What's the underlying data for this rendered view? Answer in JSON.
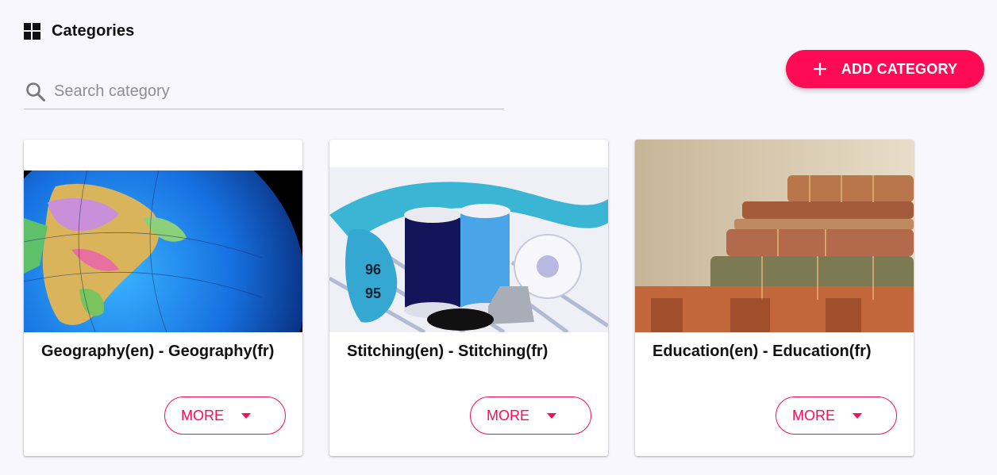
{
  "header": {
    "title": "Categories",
    "icon": "dashboard-grid-icon"
  },
  "search": {
    "placeholder": "Search category",
    "value": "",
    "icon": "search-icon"
  },
  "add_button": {
    "label": "ADD CATEGORY",
    "icon": "plus-icon",
    "color": "#ff0a55"
  },
  "accent_color": "#ff0a55",
  "cards": [
    {
      "title": "Geography(en) - Geography(fr)",
      "image": "globe-photo",
      "more_label": "MORE"
    },
    {
      "title": "Stitching(en) - Stitching(fr)",
      "image": "thread-spools-photo",
      "more_label": "MORE"
    },
    {
      "title": "Education(en) - Education(fr)",
      "image": "old-books-photo",
      "more_label": "MORE"
    }
  ]
}
